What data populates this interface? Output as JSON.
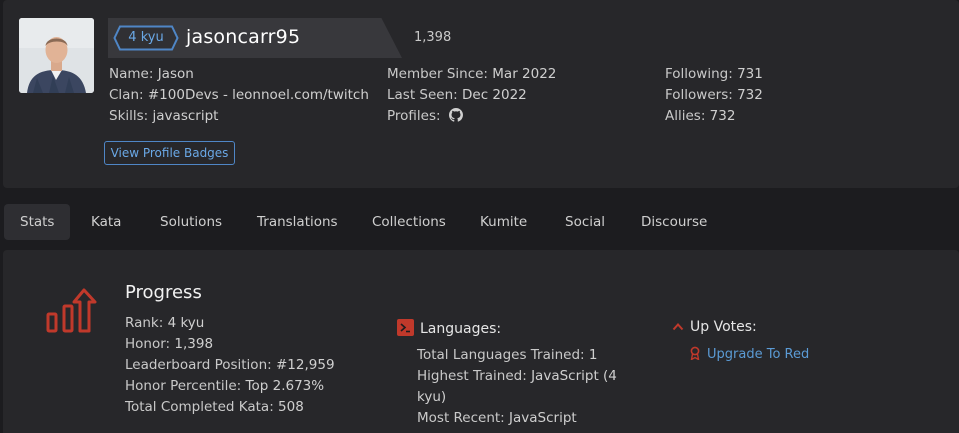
{
  "profile": {
    "rank": "4 kyu",
    "username": "jasoncarr95",
    "honor": "1,398",
    "left": [
      {
        "label": "Name:",
        "value": "Jason"
      },
      {
        "label": "Clan:",
        "value": "#100Devs - leonnoel.com/twitch"
      },
      {
        "label": "Skills:",
        "value": "javascript"
      }
    ],
    "middle": [
      {
        "label": "Member Since:",
        "value": "Mar 2022"
      },
      {
        "label": "Last Seen:",
        "value": "Dec 2022"
      },
      {
        "label": "Profiles:",
        "value": ""
      }
    ],
    "right": [
      {
        "label": "Following:",
        "value": "731"
      },
      {
        "label": "Followers:",
        "value": "732"
      },
      {
        "label": "Allies:",
        "value": "732"
      }
    ],
    "badges_button": "View Profile Badges",
    "profile_icons": [
      "github-icon"
    ]
  },
  "tabs": [
    "Stats",
    "Kata",
    "Solutions",
    "Translations",
    "Collections",
    "Kumite",
    "Social",
    "Discourse"
  ],
  "active_tab": "Stats",
  "progress": {
    "title": "Progress",
    "items": [
      {
        "label": "Rank:",
        "value": "4 kyu"
      },
      {
        "label": "Honor:",
        "value": "1,398"
      },
      {
        "label": "Leaderboard Position:",
        "value": "#12,959"
      },
      {
        "label": "Honor Percentile:",
        "value": "Top 2.673%"
      },
      {
        "label": "Total Completed Kata:",
        "value": "508"
      }
    ]
  },
  "languages": {
    "title": "Languages:",
    "items": [
      {
        "label": "Total Languages Trained:",
        "value": "1"
      },
      {
        "label": "Highest Trained:",
        "value": "JavaScript (4 kyu)"
      },
      {
        "label": "Most Recent:",
        "value": "JavaScript"
      }
    ]
  },
  "upvotes": {
    "title": "Up Votes:",
    "link": "Upgrade To Red"
  },
  "colors": {
    "accent_red": "#c0392b",
    "link_blue": "#5b9bd5",
    "rank_blue": "#4f86c6",
    "background": "#1c1c1f",
    "panel": "#27272a"
  }
}
